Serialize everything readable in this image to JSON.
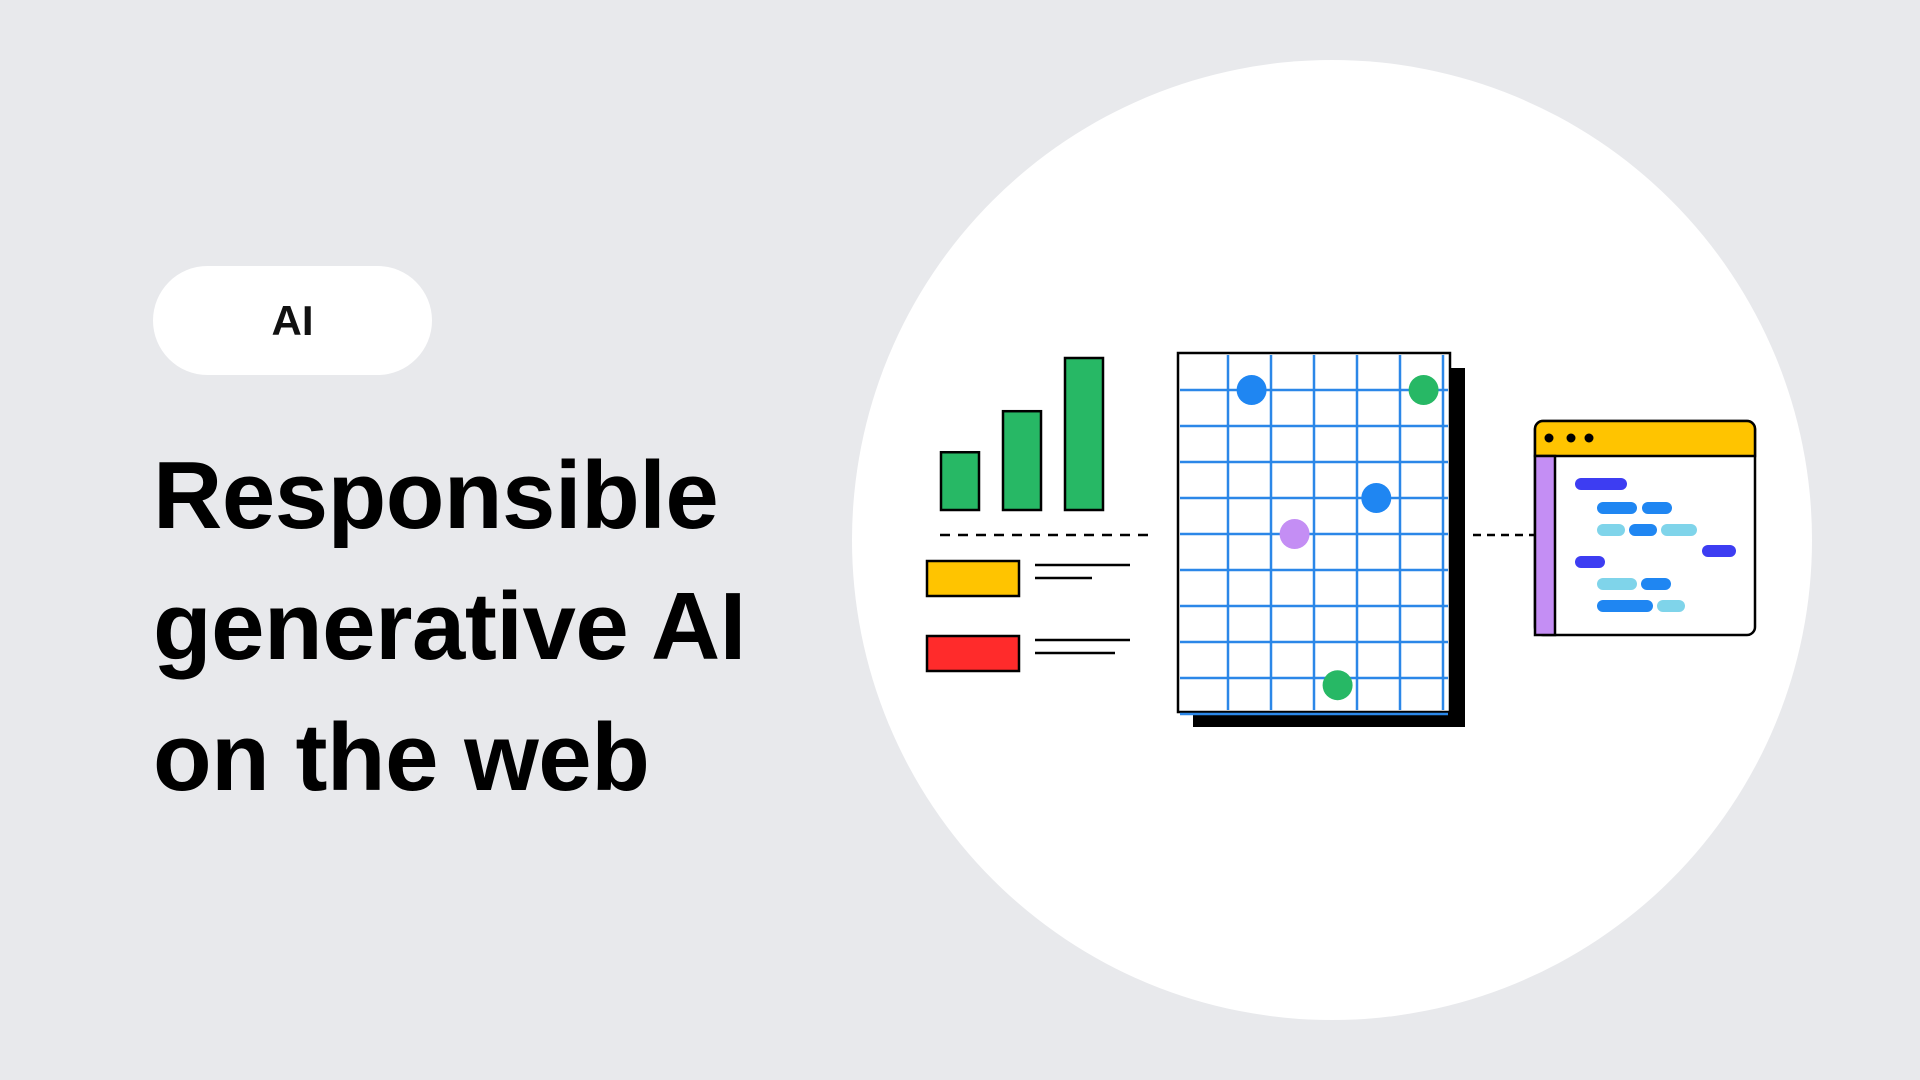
{
  "tag": {
    "label": "AI"
  },
  "headline": {
    "lines": [
      "Responsible",
      "generative AI",
      "on the web"
    ]
  },
  "colors": {
    "background": "#e8e9ec",
    "circle": "#ffffff",
    "green": "#27b865",
    "yellow": "#ffc400",
    "red": "#ff2b2b",
    "blue": "#1f86f2",
    "purple": "#c48ef4",
    "indigo": "#3d3df2",
    "light_blue": "#7fd4ea",
    "grid_line": "#2b87e8"
  },
  "illustration": {
    "icons": [
      "bar-chart-icon",
      "legend-icon",
      "scatter-grid-icon",
      "code-window-icon"
    ],
    "bars": [
      0.38,
      0.65,
      1.0
    ],
    "grid": {
      "columns": 6,
      "rows": 10
    },
    "points": [
      {
        "col": 1.2,
        "row": 1.0,
        "color": "blue"
      },
      {
        "col": 5.2,
        "row": 1.0,
        "color": "green"
      },
      {
        "col": 4.1,
        "row": 4.0,
        "color": "blue"
      },
      {
        "col": 2.2,
        "row": 5.0,
        "color": "purple"
      },
      {
        "col": 3.2,
        "row": 9.2,
        "color": "green"
      }
    ]
  }
}
